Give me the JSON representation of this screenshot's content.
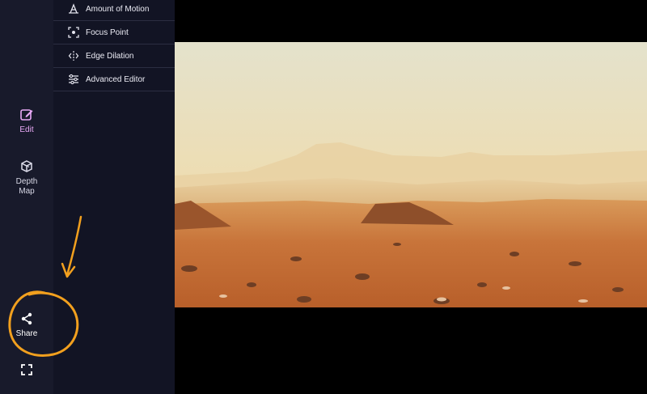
{
  "rail": {
    "edit_label": "Edit",
    "depth_map_label": "Depth\nMap",
    "share_label": "Share"
  },
  "panel": {
    "items": [
      {
        "label": "Amount of Motion",
        "icon": "motion-icon"
      },
      {
        "label": "Focus Point",
        "icon": "focus-point-icon"
      },
      {
        "label": "Edge Dilation",
        "icon": "edge-dilation-icon"
      },
      {
        "label": "Advanced Editor",
        "icon": "sliders-icon"
      }
    ]
  },
  "colors": {
    "rail_bg": "#181a2b",
    "panel_bg": "#121424",
    "annotation": "#f2a01e",
    "edit_accent": "#e9a9f7"
  }
}
